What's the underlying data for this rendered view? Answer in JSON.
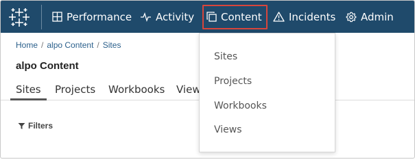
{
  "colors": {
    "topbar": "#1f4a6b",
    "highlight": "#d9453b",
    "link": "#2a5f8b"
  },
  "topnav": {
    "logo_icon": "tableau-logo-icon",
    "items": [
      {
        "label": "Performance",
        "icon": "grid-icon"
      },
      {
        "label": "Activity",
        "icon": "pulse-icon"
      },
      {
        "label": "Content",
        "icon": "copy-icon"
      },
      {
        "label": "Incidents",
        "icon": "warning-icon"
      },
      {
        "label": "Admin",
        "icon": "gear-icon"
      }
    ],
    "highlighted_item": "Content"
  },
  "breadcrumb": {
    "items": [
      "Home",
      "alpo Content",
      "Sites"
    ],
    "separator": "/"
  },
  "page": {
    "title": "alpo Content"
  },
  "tabs": {
    "items": [
      "Sites",
      "Projects",
      "Workbooks",
      "View"
    ],
    "selected": "Sites"
  },
  "filters": {
    "label": "Filters",
    "icon": "funnel-icon"
  },
  "dropdown": {
    "items": [
      "Sites",
      "Projects",
      "Workbooks",
      "Views"
    ]
  }
}
